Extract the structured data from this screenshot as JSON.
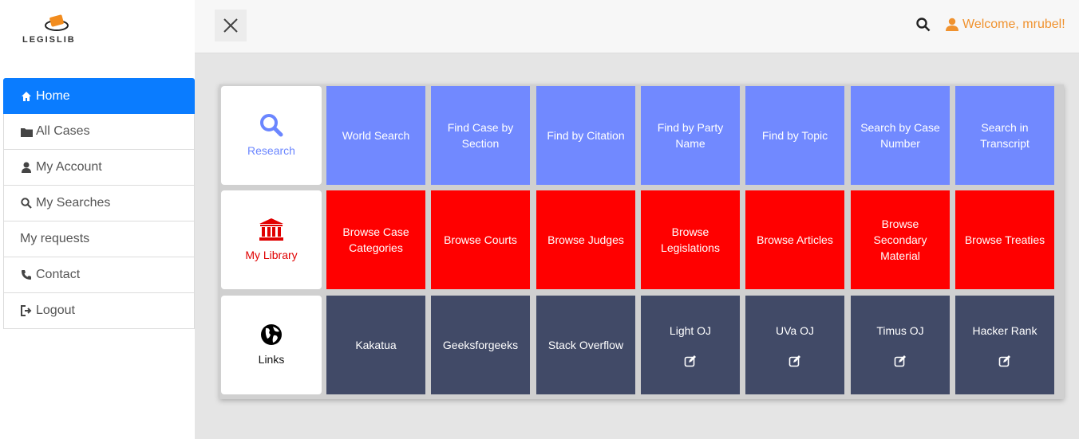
{
  "brand": {
    "name": "LEGISLIB"
  },
  "sidebar": {
    "items": [
      {
        "label": "Home",
        "icon": "home-icon",
        "active": true
      },
      {
        "label": "All Cases",
        "icon": "folder-icon"
      },
      {
        "label": "My Account",
        "icon": "user-icon"
      },
      {
        "label": "My Searches",
        "icon": "search-icon"
      },
      {
        "label": "My requests",
        "icon": ""
      },
      {
        "label": "Contact",
        "icon": "phone-icon"
      },
      {
        "label": "Logout",
        "icon": "logout-icon"
      }
    ]
  },
  "header": {
    "welcome": "Welcome, mrubel!"
  },
  "grid": {
    "rows": [
      {
        "label": "Research",
        "icon": "search-icon",
        "color": "#7189ff",
        "cells": [
          "World Search",
          "Find Case by Section",
          "Find by Citation",
          "Find by Party Name",
          "Find by Topic",
          "Search by Case Number",
          "Search in Transcript"
        ]
      },
      {
        "label": "My Library",
        "icon": "library-icon",
        "color": "#ff0000",
        "cells": [
          "Browse Case Categories",
          "Browse Courts",
          "Browse Judges",
          "Browse Legislations",
          "Browse Articles",
          "Browse Secondary Material",
          "Browse Treaties"
        ]
      },
      {
        "label": "Links",
        "icon": "globe-icon",
        "color": "#414a67",
        "cells": [
          "Kakatua",
          "Geeksforgeeks",
          "Stack Overflow",
          "Light OJ",
          "UVa OJ",
          "Timus OJ",
          "Hacker Rank"
        ]
      }
    ]
  },
  "colors": {
    "accent": "#0a7cff",
    "welcome": "#f0922e"
  }
}
